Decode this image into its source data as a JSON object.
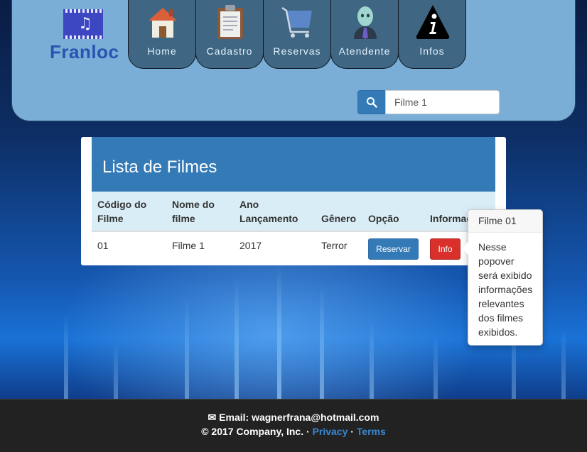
{
  "brand": {
    "name": "Franloc",
    "logo_icon": "film-music-icon"
  },
  "nav": {
    "tabs": [
      {
        "label": "Home",
        "icon": "house-icon"
      },
      {
        "label": "Cadastro",
        "icon": "clipboard-icon"
      },
      {
        "label": "Reservas",
        "icon": "cart-icon"
      },
      {
        "label": "Atendente",
        "icon": "attendant-icon"
      },
      {
        "label": "Infos",
        "icon": "info-icon"
      }
    ]
  },
  "search": {
    "value": "Filme 1",
    "icon": "search-icon"
  },
  "panel": {
    "title": "Lista de Filmes",
    "columns": [
      "Código do Filme",
      "Nome do filme",
      "Ano Lançamento",
      "Gênero",
      "Opção",
      "Informações"
    ],
    "rows": [
      {
        "codigo": "01",
        "nome": "Filme 1",
        "ano": "2017",
        "genero": "Terror",
        "opcao": "Reservar",
        "info": "Info"
      }
    ]
  },
  "popover": {
    "title": "Filme 01",
    "content": "Nesse popover será exibido informações relevantes dos filmes exibidos."
  },
  "footer": {
    "email": "Email: wagnerfrana@hotmail.com",
    "copyright": "© 2017 Company, Inc. ·",
    "privacy": "Privacy",
    "separator": "·",
    "terms": "Terms"
  },
  "colors": {
    "header_bg": "#7aaed6",
    "tab_bg": "#3f6682",
    "primary": "#337ab7",
    "danger": "#d9302c",
    "footer_bg": "#222222"
  }
}
